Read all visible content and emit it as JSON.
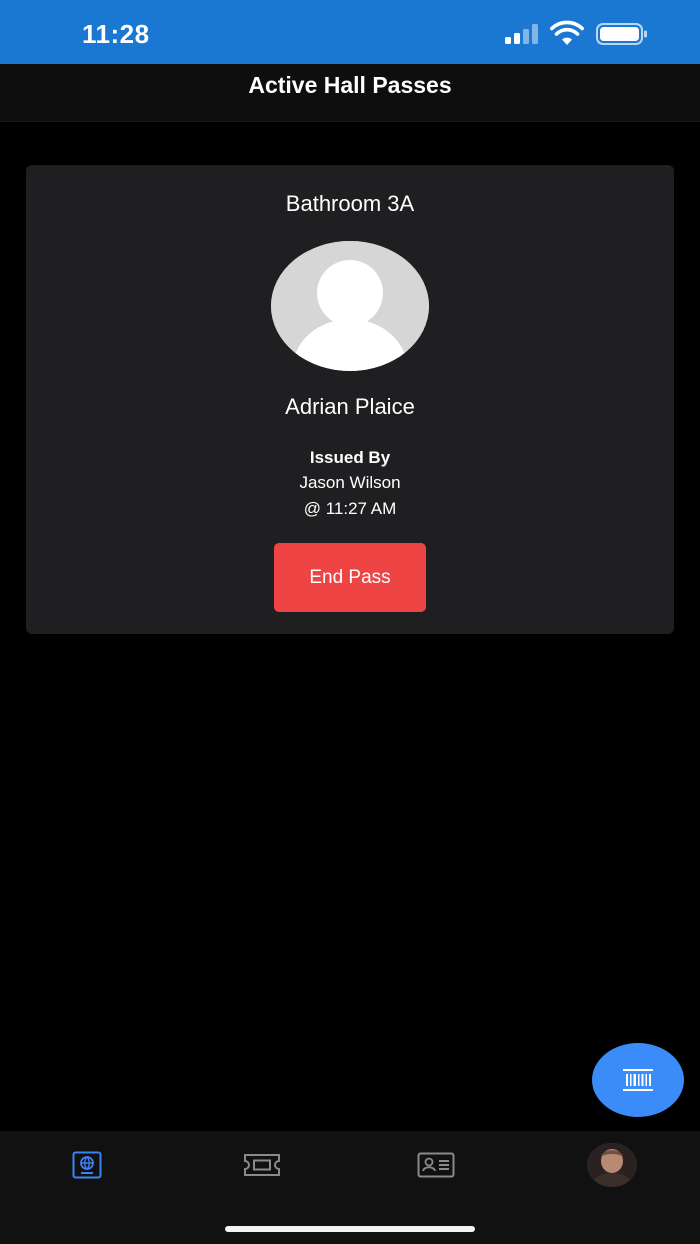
{
  "status_bar": {
    "time": "11:28"
  },
  "header": {
    "title": "Active Hall Passes"
  },
  "pass": {
    "location": "Bathroom 3A",
    "student_name": "Adrian Plaice",
    "issued_label": "Issued By",
    "issuer": "Jason Wilson",
    "issued_time": "@ 11:27 AM",
    "end_button_label": "End Pass"
  },
  "colors": {
    "status_bar": "#1a78d2",
    "end_button": "#ef4444",
    "fab": "#3b8cf8",
    "active_tab": "#3b82f6",
    "inactive_tab": "#8a8a8a"
  },
  "tabs": [
    {
      "icon": "passport-icon",
      "active": true
    },
    {
      "icon": "ticket-icon",
      "active": false
    },
    {
      "icon": "id-card-icon",
      "active": false
    },
    {
      "icon": "profile-avatar",
      "active": false
    }
  ],
  "fab": {
    "icon": "barcode-scan-icon"
  }
}
